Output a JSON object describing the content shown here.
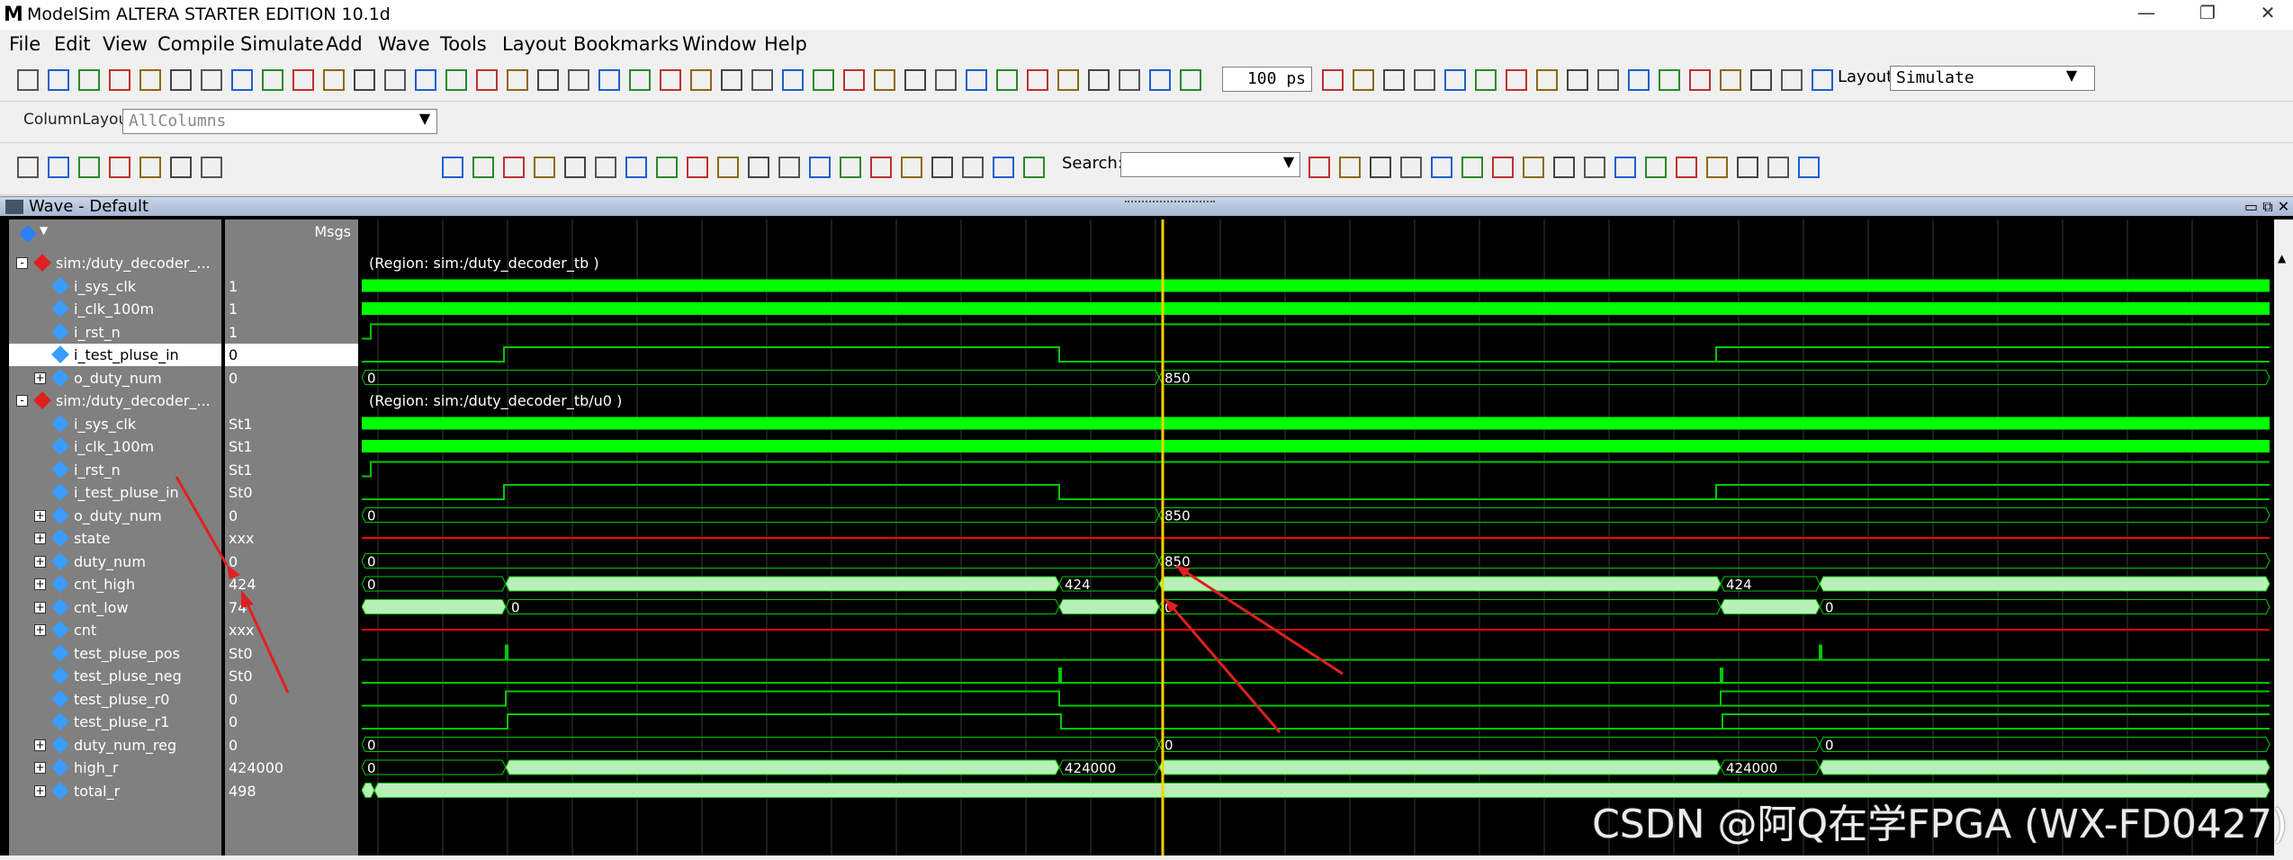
{
  "window": {
    "title": "ModelSim ALTERA STARTER EDITION 10.1d",
    "logo": "M",
    "controls": [
      "minimize-icon",
      "restore-icon",
      "close-icon"
    ]
  },
  "menu": [
    "File",
    "Edit",
    "View",
    "Compile",
    "Simulate",
    "Add",
    "Wave",
    "Tools",
    "Layout",
    "Bookmarks",
    "Window",
    "Help"
  ],
  "toolbar1": {
    "zoom_value": "100 ps",
    "layout_label": "Layout",
    "layout_value": "Simulate"
  },
  "toolbar2": {
    "column_layout_label": "ColumnLayout",
    "column_layout_value": "AllColumns"
  },
  "toolbar3": {
    "search_label": "Search:",
    "search_value": ""
  },
  "wave": {
    "panel_title": "Wave - Default",
    "msgs_header": "Msgs",
    "signals": [
      {
        "name": "sim:/duty_decoder_...",
        "value": "",
        "kind": "region",
        "expand": "-"
      },
      {
        "name": "i_sys_clk",
        "value": "1",
        "kind": "in"
      },
      {
        "name": "i_clk_100m",
        "value": "1",
        "kind": "in"
      },
      {
        "name": "i_rst_n",
        "value": "1",
        "kind": "in"
      },
      {
        "name": "i_test_pluse_in",
        "value": "0",
        "kind": "in",
        "selected": true
      },
      {
        "name": "o_duty_num",
        "value": "0",
        "kind": "bus",
        "expand": "+"
      },
      {
        "name": "sim:/duty_decoder_...",
        "value": "",
        "kind": "region",
        "expand": "-"
      },
      {
        "name": "i_sys_clk",
        "value": "St1",
        "kind": "in"
      },
      {
        "name": "i_clk_100m",
        "value": "St1",
        "kind": "in"
      },
      {
        "name": "i_rst_n",
        "value": "St1",
        "kind": "in"
      },
      {
        "name": "i_test_pluse_in",
        "value": "St0",
        "kind": "in"
      },
      {
        "name": "o_duty_num",
        "value": "0",
        "kind": "bus",
        "expand": "+"
      },
      {
        "name": "state",
        "value": "xxx",
        "kind": "bus",
        "expand": "+"
      },
      {
        "name": "duty_num",
        "value": "0",
        "kind": "bus",
        "expand": "+"
      },
      {
        "name": "cnt_high",
        "value": "424",
        "kind": "bus",
        "expand": "+"
      },
      {
        "name": "cnt_low",
        "value": "74",
        "kind": "bus",
        "expand": "+"
      },
      {
        "name": "cnt",
        "value": "xxx",
        "kind": "bus",
        "expand": "+"
      },
      {
        "name": "test_pluse_pos",
        "value": "St0",
        "kind": "in"
      },
      {
        "name": "test_pluse_neg",
        "value": "St0",
        "kind": "in"
      },
      {
        "name": "test_pluse_r0",
        "value": "0",
        "kind": "in"
      },
      {
        "name": "test_pluse_r1",
        "value": "0",
        "kind": "in"
      },
      {
        "name": "duty_num_reg",
        "value": "0",
        "kind": "bus",
        "expand": "+"
      },
      {
        "name": "high_r",
        "value": "424000",
        "kind": "bus",
        "expand": "+"
      },
      {
        "name": "total_r",
        "value": "498",
        "kind": "bus",
        "expand": "+"
      }
    ],
    "regions": [
      "(Region: sim:/duty_decoder_tb )",
      "(Region: sim:/duty_decoder_tb/u0 )"
    ],
    "bus_labels": {
      "zero": "0",
      "duty": "850",
      "cnt_high": "424",
      "high_r": "424000"
    },
    "colors": {
      "wave": "#00c800",
      "bus_fill": "#b8f0b8",
      "cursor": "#ffd000",
      "red": "#ff0000",
      "bright": "#00ff00"
    }
  },
  "watermark": "CSDN @阿Q在学FPGA (WX-FD0427)"
}
